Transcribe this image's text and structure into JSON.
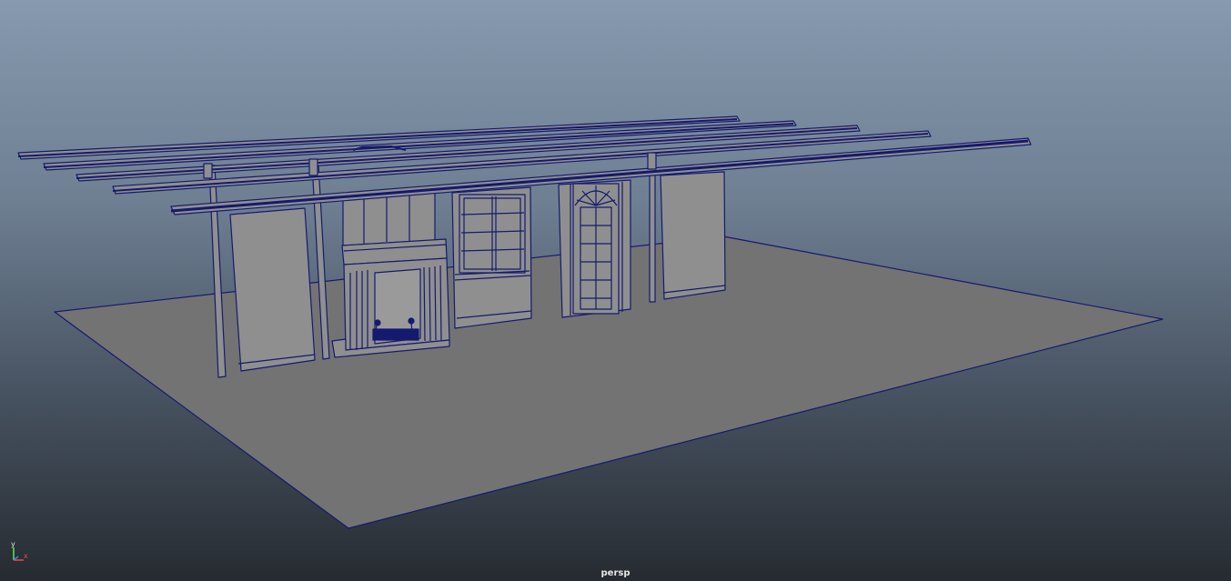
{
  "viewport": {
    "camera_name": "persp"
  },
  "axis_gizmo": {
    "y_label": "y",
    "x_label": "x"
  },
  "colors": {
    "wireframe": "#141a6e",
    "geometry_fill": "#8f8f8f",
    "ground_fill": "#737373",
    "axis_y": "#4ff04f",
    "axis_x": "#f04848",
    "axis_z": "#4a7cf0"
  }
}
